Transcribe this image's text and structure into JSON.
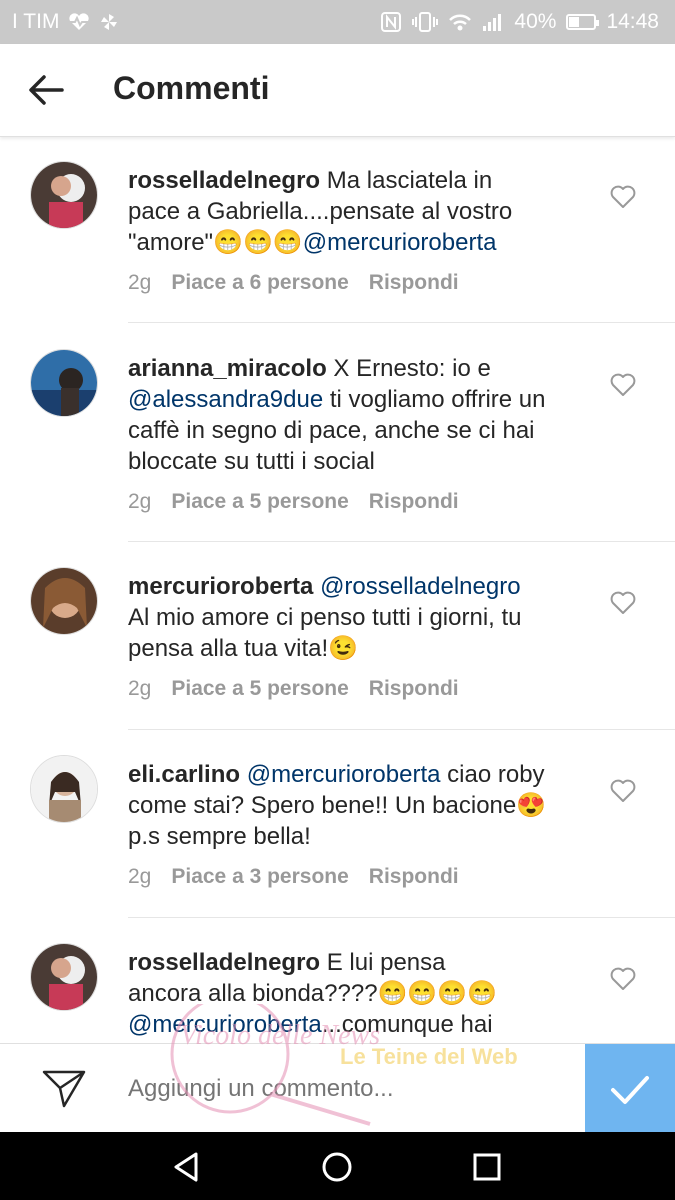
{
  "status_bar": {
    "carrier": "I TIM",
    "battery": "40%",
    "battery_level": 0.4,
    "time": "14:48"
  },
  "header": {
    "title": "Commenti"
  },
  "comments": [
    {
      "username": "rosselladelnegro",
      "lines": [
        "Ma lasciatela in",
        "pace a Gabriella....pensate al vostro"
      ],
      "last_line_text": "\"amore\"😁😁😁",
      "last_line_mention": "@mercurioroberta",
      "time": "2g",
      "likes": "Piace a 6 persone",
      "reply": "Rispondi"
    },
    {
      "username": "arianna_miracolo",
      "first_text": "X Ernesto: io e",
      "mention": "@alessandra9due",
      "mention_after": " ti vogliamo offrire un",
      "lines": [
        "caffè in segno di pace, anche se ci hai",
        "bloccate su tutti i social"
      ],
      "time": "2g",
      "likes": "Piace a 5 persone",
      "reply": "Rispondi"
    },
    {
      "username": "mercurioroberta",
      "first_mention": "@rosselladelnegro",
      "lines": [
        "Al mio amore ci penso tutti i giorni, tu",
        "pensa alla tua vita!😉"
      ],
      "time": "2g",
      "likes": "Piace a 5 persone",
      "reply": "Rispondi"
    },
    {
      "username": "eli.carlino",
      "first_mention": "@mercurioroberta",
      "first_after": " ciao roby",
      "lines": [
        "come stai? Spero bene!! Un bacione😍",
        "p.s sempre bella!"
      ],
      "time": "2g",
      "likes": "Piace a 3 persone",
      "reply": "Rispondi"
    },
    {
      "username": "rosselladelnegro",
      "first_text": "E lui pensa",
      "lines": [
        "ancora alla bionda????😁😁😁😁"
      ],
      "last_mention": "@mercurioroberta",
      "last_after": "...comunque hai"
    }
  ],
  "composer": {
    "placeholder": "Aggiungi un commento..."
  },
  "watermark": {
    "text1": "Vicolo delle News",
    "text2": "Le Teine del Web"
  },
  "colors": {
    "mention": "#003569",
    "post_button": "#6fb5f0",
    "status_bar": "#c9c9c9"
  }
}
